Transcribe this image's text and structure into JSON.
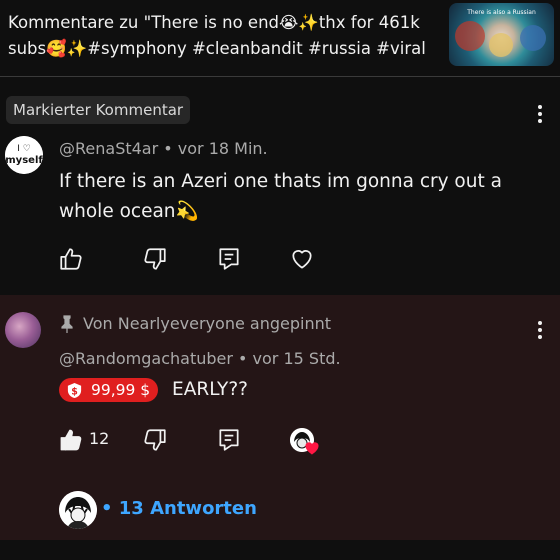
{
  "header": {
    "title": "Kommentare zu \"There is no end😭✨thx for 461k subs🥰✨#symphony #cleanbandit #russia #viral",
    "thumb_caption": "There is also a Russian"
  },
  "highlighted_comment": {
    "badge": "Markierter Kommentar",
    "author": "@RenaSt4ar",
    "time": "vor 18 Min.",
    "author_line": "@RenaSt4ar • vor 18 Min.",
    "text": "If there is an Azeri one thats im gonna cry out a whole ocean💫",
    "avatar_text": "myself"
  },
  "pinned_comment": {
    "pinned_by": "Von Nearlyeveryone angepinnt",
    "author_line": "@Randomgachatuber • vor 15 Std.",
    "super_thanks": "99,99 $",
    "text": "EARLY??",
    "like_count": "12",
    "replies": "• 13 Antworten"
  },
  "colors": {
    "background": "#0f0f0f",
    "pinned_background": "#241516",
    "accent_blue": "#3ea6ff",
    "super_thanks_red": "#e01f1f",
    "heart_red": "#ff1744"
  },
  "icons": [
    "like-icon",
    "dislike-icon",
    "reply-icon",
    "heart-icon",
    "pin-icon",
    "more-icon",
    "dollar-coin-icon"
  ]
}
